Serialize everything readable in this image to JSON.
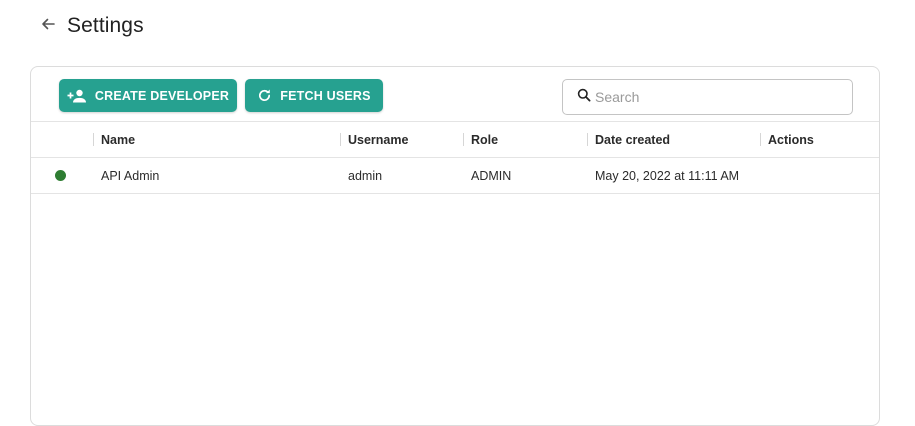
{
  "header": {
    "back_icon": "arrow-left-icon",
    "title": "Settings"
  },
  "toolbar": {
    "create_developer_label": "CREATE DEVELOPER",
    "create_developer_icon": "person-add-icon",
    "fetch_users_label": "FETCH USERS",
    "fetch_users_icon": "refresh-icon",
    "search": {
      "placeholder": "Search",
      "value": "",
      "icon": "search-icon"
    }
  },
  "table": {
    "columns": [
      "Name",
      "Username",
      "Role",
      "Date created",
      "Actions"
    ],
    "rows": [
      {
        "status": "active",
        "name": "API Admin",
        "username": "admin",
        "role": "ADMIN",
        "date_created": "May 20, 2022 at 11:11 AM",
        "actions": ""
      }
    ]
  },
  "colors": {
    "accent": "#26a190",
    "status_active": "#2e7d32"
  }
}
